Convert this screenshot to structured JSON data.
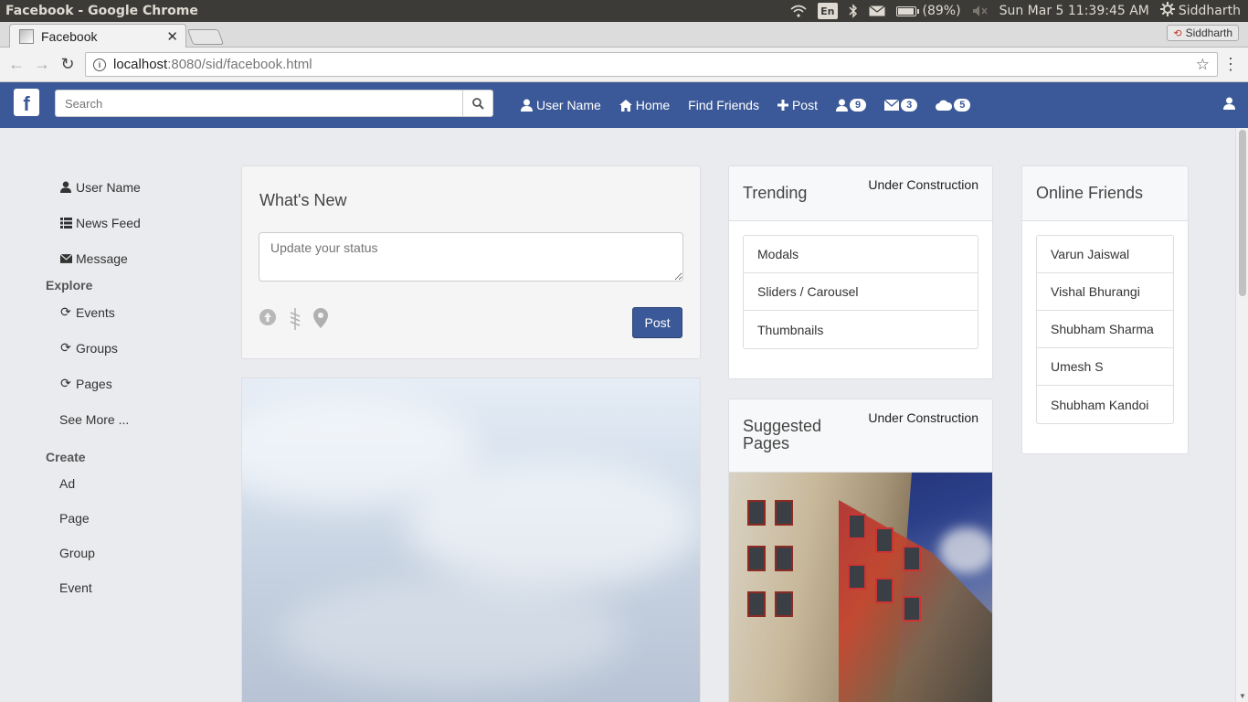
{
  "os": {
    "window_title": "Facebook - Google Chrome",
    "lang": "En",
    "battery": "(89%)",
    "battery_level": 0.89,
    "clock": "Sun Mar  5 11:39:45 AM",
    "user": "Siddharth"
  },
  "browser": {
    "tab_title": "Facebook",
    "profile_name": "Siddharth",
    "url_host": "localhost",
    "url_rest": ":8080/sid/facebook.html"
  },
  "navbar": {
    "logo": "f",
    "search_placeholder": "Search",
    "links": {
      "user": "User Name",
      "home": "Home",
      "find_friends": "Find Friends",
      "post": "Post"
    },
    "badges": {
      "friends": "9",
      "messages": "3",
      "notifications": "5"
    }
  },
  "sidebar": {
    "profile": "User Name",
    "news_feed": "News Feed",
    "message": "Message",
    "explore_head": "Explore",
    "events": "Events",
    "groups": "Groups",
    "pages": "Pages",
    "see_more": "See More ...",
    "create_head": "Create",
    "create_ad": "Ad",
    "create_page": "Page",
    "create_group": "Group",
    "create_event": "Event"
  },
  "whats_new": {
    "title": "What's New",
    "status_placeholder": "Update your status",
    "post_label": "Post"
  },
  "trending": {
    "title": "Trending",
    "note": "Under Construction",
    "items": [
      "Modals",
      "Sliders / Carousel",
      "Thumbnails"
    ]
  },
  "suggested": {
    "title_line1": "Suggested",
    "title_line2": "Pages",
    "note": "Under Construction"
  },
  "online": {
    "title": "Online Friends",
    "friends": [
      "Varun Jaiswal",
      "Vishal Bhurangi",
      "Shubham Sharma",
      "Umesh S",
      "Shubham Kandoi"
    ]
  },
  "icons": {
    "wifi": "wifi-icon",
    "bluetooth": "bluetooth-icon",
    "mail": "mail-icon",
    "volume": "volume-muted-icon",
    "settings": "gear-icon"
  },
  "colors": {
    "fb_blue": "#3b5998",
    "page_bg": "#e9ebee"
  }
}
